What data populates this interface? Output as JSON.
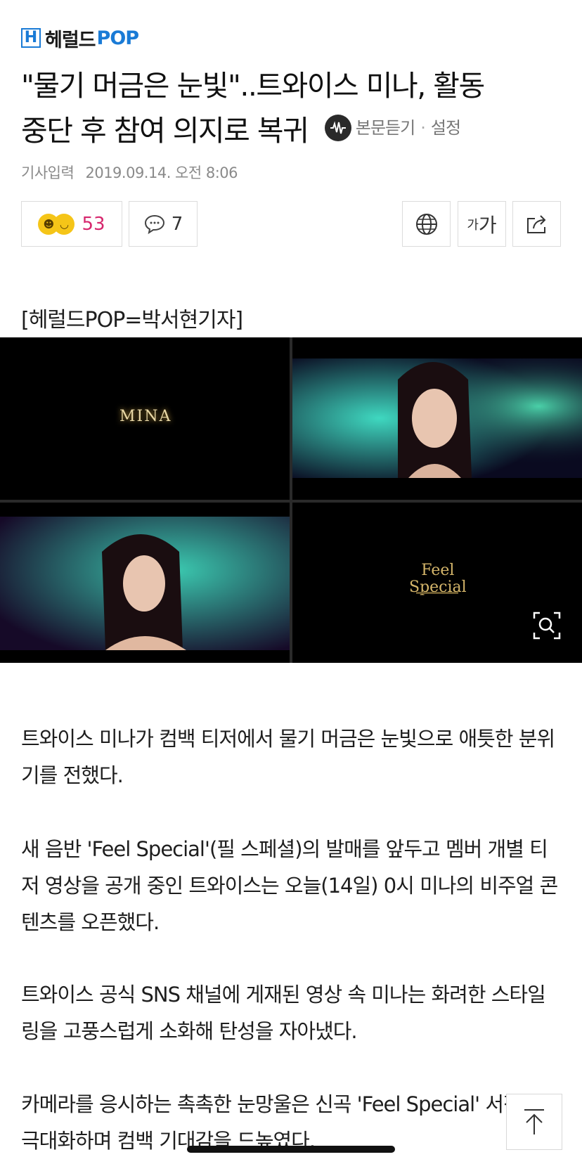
{
  "header": {
    "logo_ko": "헤럴드",
    "logo_en": "POP"
  },
  "article": {
    "title_line1": "\"물기 머금은 눈빛\"..트와이스 미나, 활동",
    "title_line2": "중단 후 참여 의지로 복귀",
    "listen_label": "본문듣기",
    "settings_label": "설정",
    "meta_label": "기사입력",
    "meta_date": "2019.09.14. 오전 8:06",
    "byline": "[헤럴드POP=박서현기자]",
    "paragraphs": [
      "트와이스 미나가 컴백 티저에서 물기 머금은 눈빛으로 애틋한 분위기를 전했다.",
      "새 음반 'Feel Special'(필 스페셜)의 발매를 앞두고 멤버 개별 티저 영상을 공개 중인 트와이스는 오늘(14일) 0시 미나의 비주얼 콘텐츠를 오픈했다.",
      "트와이스 공식 SNS 채널에 게재된 영상 속 미나는 화려한 스타일링을 고풍스럽게 소화해 탄성을 자아냈다.",
      "카메라를 응시하는 촉촉한 눈망울은 신곡 'Feel Special' 서정성을 극대화하며 컴백 기대감을 드높였다."
    ]
  },
  "actions": {
    "reaction_count": "53",
    "comment_count": "7",
    "font_small": "가",
    "font_big": "가"
  },
  "photo": {
    "panel1_text": "MINA",
    "panel4_line1": "Feel",
    "panel4_line2": "Special"
  },
  "icons": {
    "logo": "herald-h-icon",
    "listen": "speaker-wave-icon",
    "reaction": "smile-emoji-icon",
    "comment": "speech-bubble-icon",
    "globe": "globe-icon",
    "share": "share-icon",
    "zoom": "magnify-icon",
    "top": "arrow-up-icon"
  },
  "colors": {
    "brand_blue": "#1a7bd6",
    "reaction_pink": "#d6276d"
  }
}
